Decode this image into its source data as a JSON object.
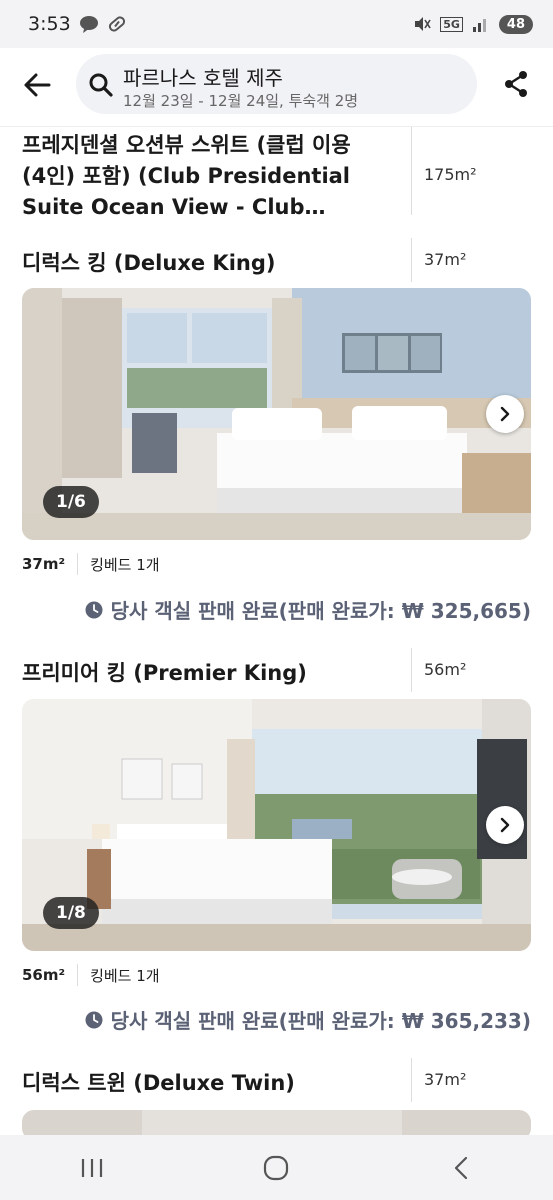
{
  "status_bar": {
    "time": "3:53",
    "network": "5G",
    "battery": "48"
  },
  "header": {
    "search_title": "파르나스 호텔 제주",
    "search_subtitle": "12월 23일 - 12월 24일, 투숙객 2명"
  },
  "rooms": [
    {
      "name": "프레지덴셜 오션뷰 스위트 (클럽 이용(4인) 포함) (Club Presidential Suite Ocean View - Club…",
      "size": "175m²"
    },
    {
      "name": "디럭스 킹 (Deluxe King)",
      "size": "37m²",
      "photo_counter": "1/6",
      "spec_size": "37m²",
      "bed": "킹베드 1개",
      "soldout_text": "당사 객실 판매 완료(판매 완료가: ₩ 325,665)"
    },
    {
      "name": "프리미어 킹 (Premier King)",
      "size": "56m²",
      "photo_counter": "1/8",
      "spec_size": "56m²",
      "bed": "킹베드 1개",
      "soldout_text": "당사 객실 판매 완료(판매 완료가: ₩ 365,233)"
    },
    {
      "name": "디럭스 트윈 (Deluxe Twin)",
      "size": "37m²"
    }
  ],
  "colors": {
    "accent_text": "#5c6275",
    "bar_bg": "#f3f3f6"
  },
  "icons": {
    "back": "arrow-left-icon",
    "search": "search-icon",
    "share": "share-icon",
    "clock": "clock-icon",
    "next": "chevron-right-icon",
    "nav_recents": "recents-icon",
    "nav_home": "home-icon",
    "nav_back": "nav-back-icon"
  }
}
